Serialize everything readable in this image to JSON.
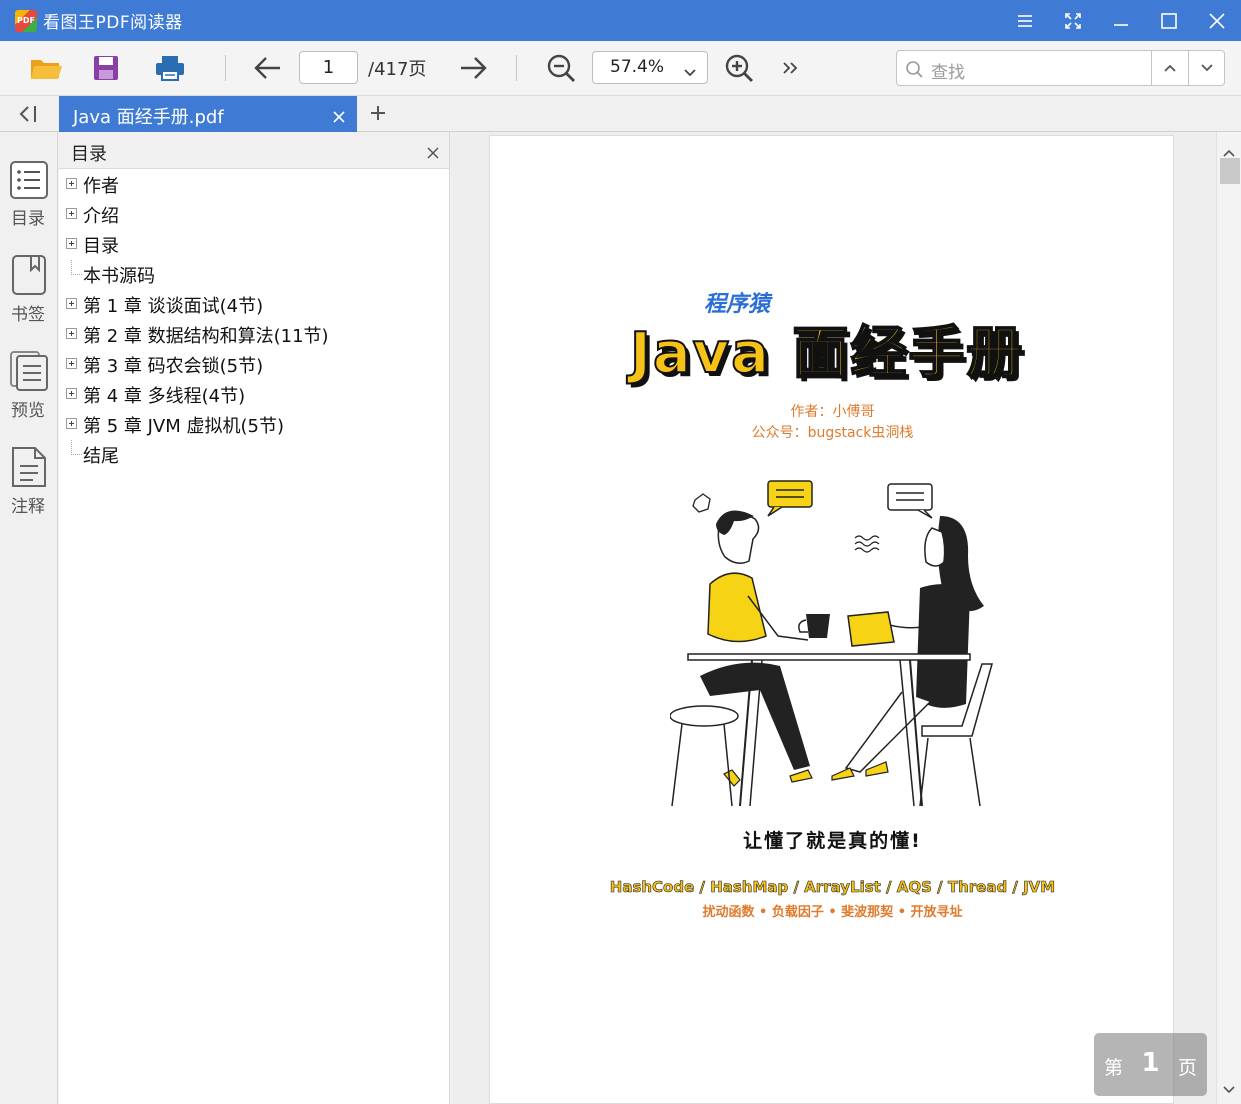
{
  "app": {
    "logo_text": "PDF",
    "title": "看图王PDF阅读器"
  },
  "toolbar": {
    "page_input": "1",
    "page_total": "/417页",
    "zoom": "57.4%",
    "search_placeholder": "查找"
  },
  "tabs": {
    "active_title": "Java 面经手册.pdf"
  },
  "rail": {
    "items": [
      {
        "label": "目录",
        "icon": "list-icon"
      },
      {
        "label": "书签",
        "icon": "bookmark-icon"
      },
      {
        "label": "预览",
        "icon": "thumbnails-icon"
      },
      {
        "label": "注释",
        "icon": "annotation-icon"
      }
    ]
  },
  "outline": {
    "title": "目录",
    "items": [
      {
        "label": "作者",
        "expandable": true
      },
      {
        "label": "介绍",
        "expandable": true
      },
      {
        "label": "目录",
        "expandable": true
      },
      {
        "label": "本书源码",
        "expandable": false
      },
      {
        "label": "第 1 章 谈谈面试(4节)",
        "expandable": true
      },
      {
        "label": "第 2 章 数据结构和算法(11节)",
        "expandable": true
      },
      {
        "label": "第 3 章 码农会锁(5节)",
        "expandable": true
      },
      {
        "label": "第 4 章 多线程(4节)",
        "expandable": true
      },
      {
        "label": "第 5 章 JVM 虚拟机(5节)",
        "expandable": true
      },
      {
        "label": "结尾",
        "expandable": false
      }
    ]
  },
  "document": {
    "brand": "程序猿",
    "title": "Java 面经手册",
    "author": "作者：小傅哥",
    "account": "公众号：bugstack虫洞栈",
    "slogan": "让懂了就是真的懂!",
    "topics": "HashCode / HashMap / ArrayList / AQS / Thread / JVM",
    "subtopics": "扰动函数 • 负载因子 • 斐波那契 • 开放寻址"
  },
  "page_badge": {
    "prefix": "第",
    "number": "1",
    "suffix": "页"
  },
  "colors": {
    "accent": "#3f7bd4",
    "cover_yellow": "#f6c217",
    "cover_orange": "#e07b2e"
  }
}
